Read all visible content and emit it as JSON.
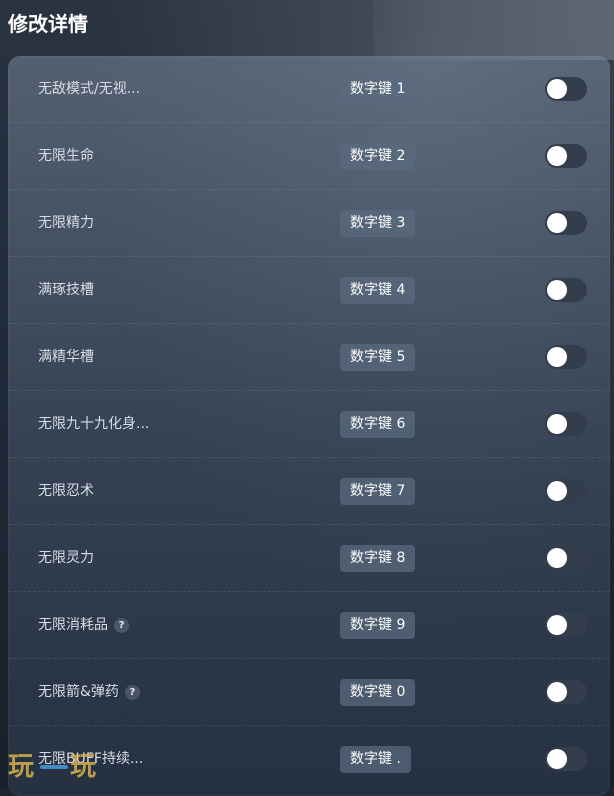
{
  "header": {
    "title": "修改详情"
  },
  "cheats": [
    {
      "label": "无敌模式/无视...",
      "hotkey": "数字键 1",
      "enabled": false,
      "help": ""
    },
    {
      "label": "无限生命",
      "hotkey": "数字键 2",
      "enabled": false,
      "help": ""
    },
    {
      "label": "无限精力",
      "hotkey": "数字键 3",
      "enabled": false,
      "help": ""
    },
    {
      "label": "满琢技槽",
      "hotkey": "数字键 4",
      "enabled": false,
      "help": ""
    },
    {
      "label": "满精华槽",
      "hotkey": "数字键 5",
      "enabled": false,
      "help": ""
    },
    {
      "label": "无限九十九化身...",
      "hotkey": "数字键 6",
      "enabled": false,
      "help": ""
    },
    {
      "label": "无限忍术",
      "hotkey": "数字键 7",
      "enabled": false,
      "help": ""
    },
    {
      "label": "无限灵力",
      "hotkey": "数字键 8",
      "enabled": false,
      "help": ""
    },
    {
      "label": "无限消耗品",
      "hotkey": "数字键 9",
      "enabled": false,
      "help": "?"
    },
    {
      "label": "无限箭&弹药",
      "hotkey": "数字键 0",
      "enabled": false,
      "help": "?"
    },
    {
      "label": "无限BUFF持续...",
      "hotkey": "数字键 .",
      "enabled": false,
      "help": ""
    }
  ],
  "colors": {
    "toggle_off": "#343d4b",
    "knob": "#ffffff",
    "key_badge": "#5a697d"
  }
}
